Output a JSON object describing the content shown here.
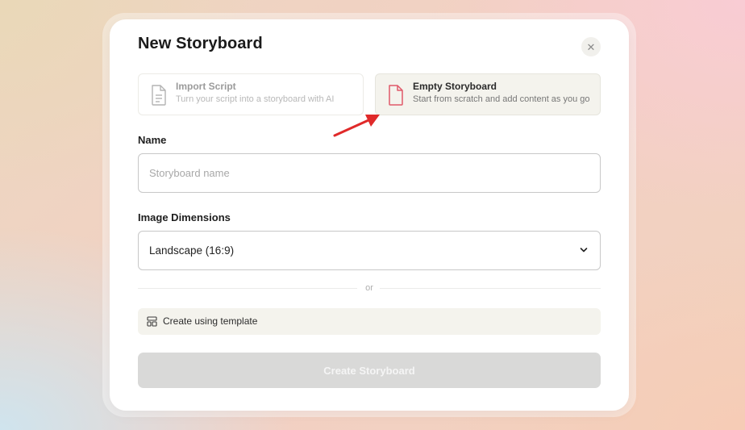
{
  "modal": {
    "title": "New Storyboard",
    "close_icon": "close-icon"
  },
  "options": {
    "import": {
      "title": "Import Script",
      "description": "Turn your script into a storyboard with AI",
      "icon": "document-icon",
      "state": "disabled"
    },
    "empty": {
      "title": "Empty Storyboard",
      "description": "Start from scratch and add content as you go",
      "icon": "document-icon",
      "state": "selected",
      "icon_color": "#e0596a"
    }
  },
  "annotation": {
    "arrow_color": "#e02a2a"
  },
  "form": {
    "name_label": "Name",
    "name_placeholder": "Storyboard name",
    "name_value": "",
    "dimensions_label": "Image Dimensions",
    "dimensions_value": "Landscape (16:9)",
    "dimensions_icon": "chevron-down-icon"
  },
  "divider": {
    "text": "or"
  },
  "template": {
    "label": "Create using template",
    "icon": "template-layout-icon"
  },
  "actions": {
    "create_label": "Create Storyboard",
    "create_state": "disabled"
  }
}
